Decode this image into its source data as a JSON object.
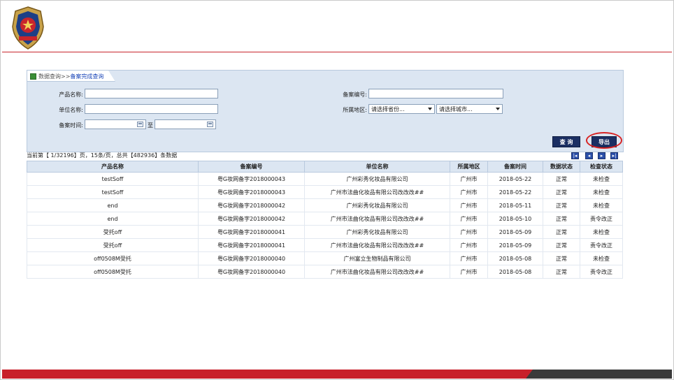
{
  "breadcrumb": {
    "root": "数据查询>>",
    "current": "备案完成查询"
  },
  "form": {
    "product_name_label": "产品名称:",
    "company_name_label": "单位名称:",
    "record_date_label": "备案时间:",
    "record_date_to": "至",
    "record_no_label": "备案编号:",
    "region_label": "所属地区:",
    "province_placeholder": "请选择省份...",
    "city_placeholder": "请选择城市..."
  },
  "actions": {
    "query_label": "查 询",
    "export_label": "导出"
  },
  "pager": {
    "summary": "当前第【 1/32196】页，15条/页，总共【482936】条数据"
  },
  "table": {
    "columns": [
      "产品名称",
      "备案编号",
      "单位名称",
      "所属地区",
      "备案时间",
      "数据状态",
      "检查状态"
    ],
    "rows": [
      [
        "testSoff",
        "粤G妆网备字2018000043",
        "广州彩秀化妆品有限公司",
        "广州市",
        "2018-05-22",
        "正常",
        "未检查"
      ],
      [
        "testSoff",
        "粤G妆网备字2018000043",
        "广州市法曲化妆品有限公司改改改##",
        "广州市",
        "2018-05-22",
        "正常",
        "未检查"
      ],
      [
        "end",
        "粤G妆网备字2018000042",
        "广州彩秀化妆品有限公司",
        "广州市",
        "2018-05-11",
        "正常",
        "未检查"
      ],
      [
        "end",
        "粤G妆网备字2018000042",
        "广州市法曲化妆品有限公司改改改##",
        "广州市",
        "2018-05-10",
        "正常",
        "责令改正"
      ],
      [
        "受托off",
        "粤G妆网备字2018000041",
        "广州彩秀化妆品有限公司",
        "广州市",
        "2018-05-09",
        "正常",
        "未检查"
      ],
      [
        "受托off",
        "粤G妆网备字2018000041",
        "广州市法曲化妆品有限公司改改改##",
        "广州市",
        "2018-05-09",
        "正常",
        "责令改正"
      ],
      [
        "off0508M受托",
        "粤G妆网备字2018000040",
        "广州富立生物制品有限公司",
        "广州市",
        "2018-05-08",
        "正常",
        "未检查"
      ],
      [
        "off0508M受托",
        "粤G妆网备字2018000040",
        "广州市法曲化妆品有限公司改改改##",
        "广州市",
        "2018-05-08",
        "正常",
        "责令改正"
      ]
    ]
  },
  "colors": {
    "accent_red": "#c8252c",
    "panel_blue": "#dce6f2",
    "button_navy": "#1b2f63",
    "link_blue": "#1a40c0"
  }
}
